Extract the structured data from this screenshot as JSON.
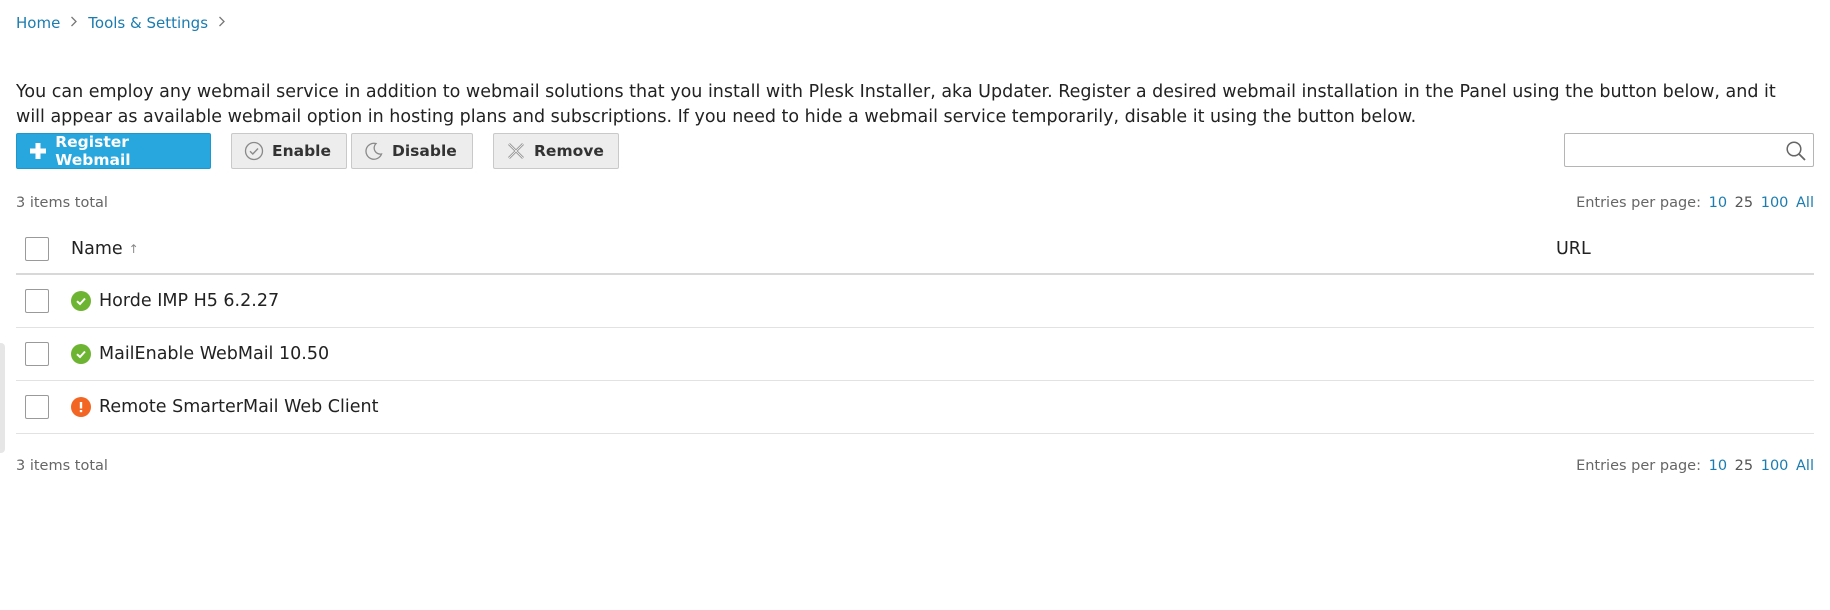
{
  "breadcrumb": {
    "items": [
      "Home",
      "Tools & Settings"
    ],
    "separator": ">"
  },
  "description": "You can employ any webmail service in addition to webmail solutions that you install with Plesk Installer, aka Updater. Register a desired webmail installation in the Panel using the button below, and it will appear as available webmail option in hosting plans and subscriptions. If you need to hide a webmail service temporarily, disable it using the button below.",
  "toolbar": {
    "register_label": "Register Webmail",
    "enable_label": "Enable",
    "disable_label": "Disable",
    "remove_label": "Remove",
    "search_placeholder": ""
  },
  "summary": {
    "items_total": "3 items total",
    "entries_label": "Entries per page:",
    "entries_options": [
      "10",
      "25",
      "100",
      "All"
    ],
    "entries_selected": "25"
  },
  "table": {
    "columns": {
      "name": "Name",
      "url": "URL"
    },
    "sort_indicator": "↑",
    "rows": [
      {
        "name": "Horde IMP H5 6.2.27",
        "status": "ok",
        "url": ""
      },
      {
        "name": "MailEnable WebMail 10.50",
        "status": "ok",
        "url": ""
      },
      {
        "name": "Remote SmarterMail Web Client",
        "status": "warning",
        "url": ""
      }
    ]
  },
  "colors": {
    "primary": "#28a7df",
    "link": "#1a7cb0",
    "status_ok": "#6db432",
    "status_warning": "#f26522"
  }
}
